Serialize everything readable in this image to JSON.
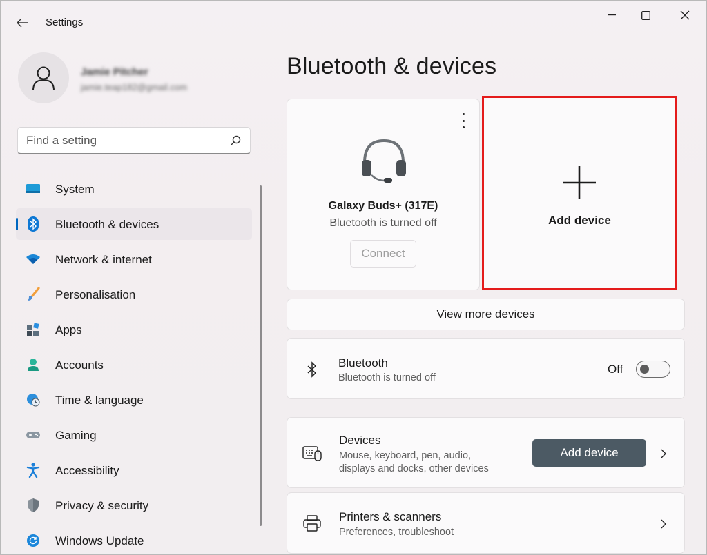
{
  "window": {
    "app_title": "Settings"
  },
  "profile": {
    "name": "Jamie Pitcher",
    "email": "jamie.teap182@gmail.com"
  },
  "search": {
    "placeholder": "Find a setting"
  },
  "nav": {
    "items": [
      {
        "label": "System",
        "icon": "monitor-icon",
        "active": false
      },
      {
        "label": "Bluetooth & devices",
        "icon": "bluetooth-icon",
        "active": true
      },
      {
        "label": "Network & internet",
        "icon": "wifi-icon",
        "active": false
      },
      {
        "label": "Personalisation",
        "icon": "brush-icon",
        "active": false
      },
      {
        "label": "Apps",
        "icon": "apps-icon",
        "active": false
      },
      {
        "label": "Accounts",
        "icon": "person-icon",
        "active": false
      },
      {
        "label": "Time & language",
        "icon": "globe-clock-icon",
        "active": false
      },
      {
        "label": "Gaming",
        "icon": "gamepad-icon",
        "active": false
      },
      {
        "label": "Accessibility",
        "icon": "accessibility-icon",
        "active": false
      },
      {
        "label": "Privacy & security",
        "icon": "shield-icon",
        "active": false
      },
      {
        "label": "Windows Update",
        "icon": "update-icon",
        "active": false
      }
    ]
  },
  "main": {
    "title": "Bluetooth & devices",
    "device_card": {
      "name": "Galaxy Buds+ (317E)",
      "status": "Bluetooth is turned off",
      "connect_label": "Connect"
    },
    "add_card": {
      "label": "Add device"
    },
    "view_more_label": "View more devices",
    "bluetooth_row": {
      "title": "Bluetooth",
      "subtitle": "Bluetooth is turned off",
      "toggle_state": "Off"
    },
    "devices_row": {
      "title": "Devices",
      "subtitle_line1": "Mouse, keyboard, pen, audio,",
      "subtitle_line2": "displays and docks, other devices",
      "button_label": "Add device"
    },
    "printers_row": {
      "title": "Printers & scanners",
      "subtitle": "Preferences, troubleshoot"
    }
  },
  "colors": {
    "accent": "#0067c0",
    "highlight_box": "#e41b1b",
    "add_button": "#4c5a64"
  }
}
